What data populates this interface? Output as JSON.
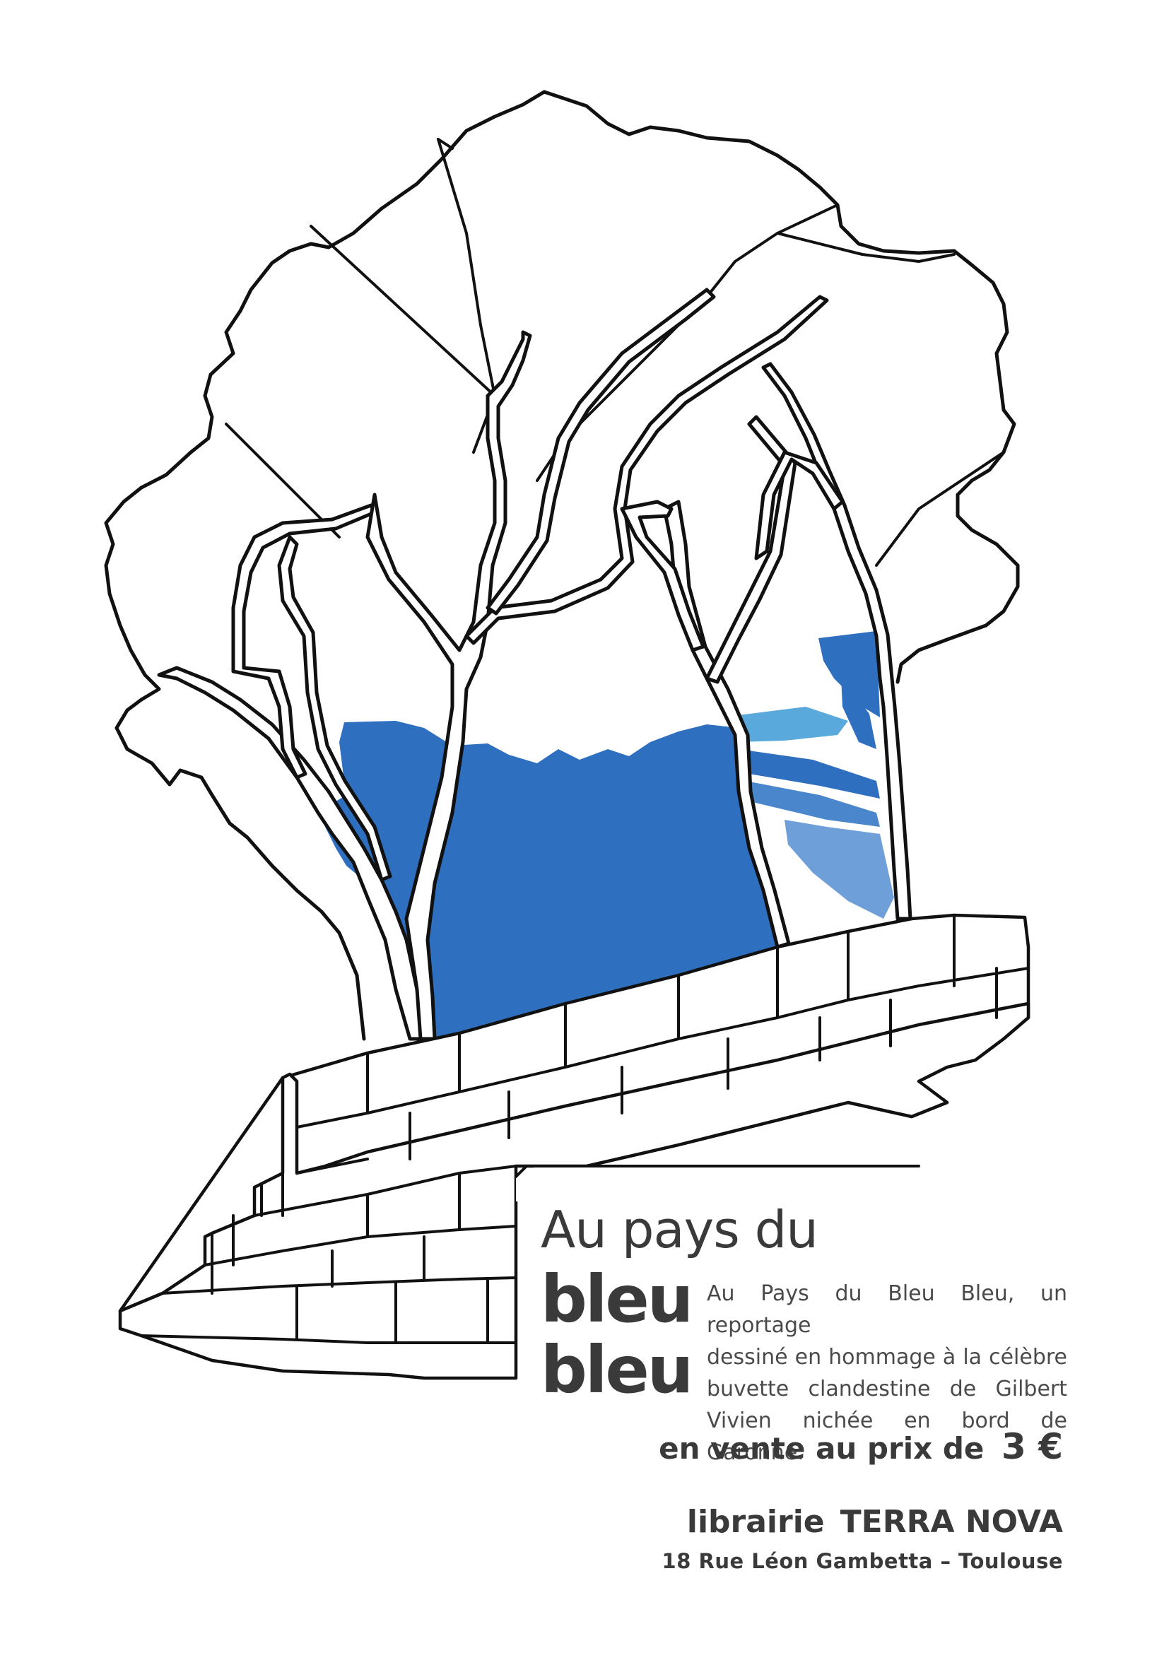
{
  "poster": {
    "title_line1": "Au pays du",
    "title_line2": "bleu",
    "title_line3": "bleu",
    "description_lines": [
      "Au Pays du Bleu Bleu, un reportage",
      "dessiné en hommage à la célèbre",
      "buvette clandestine de Gilbert",
      "Vivien nichée en bord de Garonne."
    ],
    "price_prefix": "en vente au prix de",
    "price_amount": "3 €",
    "shop_prefix": "librairie",
    "shop_name": "TERRA NOVA",
    "address": "18 Rue Léon Gambetta – Toulouse"
  },
  "colors": {
    "deep_blue": "#2f6fbf",
    "sky_blue": "#5aa9dc",
    "mid_blue": "#4a86cc",
    "pale_blue": "#6f9fd8",
    "ink": "#111111",
    "text": "#3a3a3a"
  },
  "illustration": {
    "name": "ink-drawing-trees-and-stone-wall"
  }
}
